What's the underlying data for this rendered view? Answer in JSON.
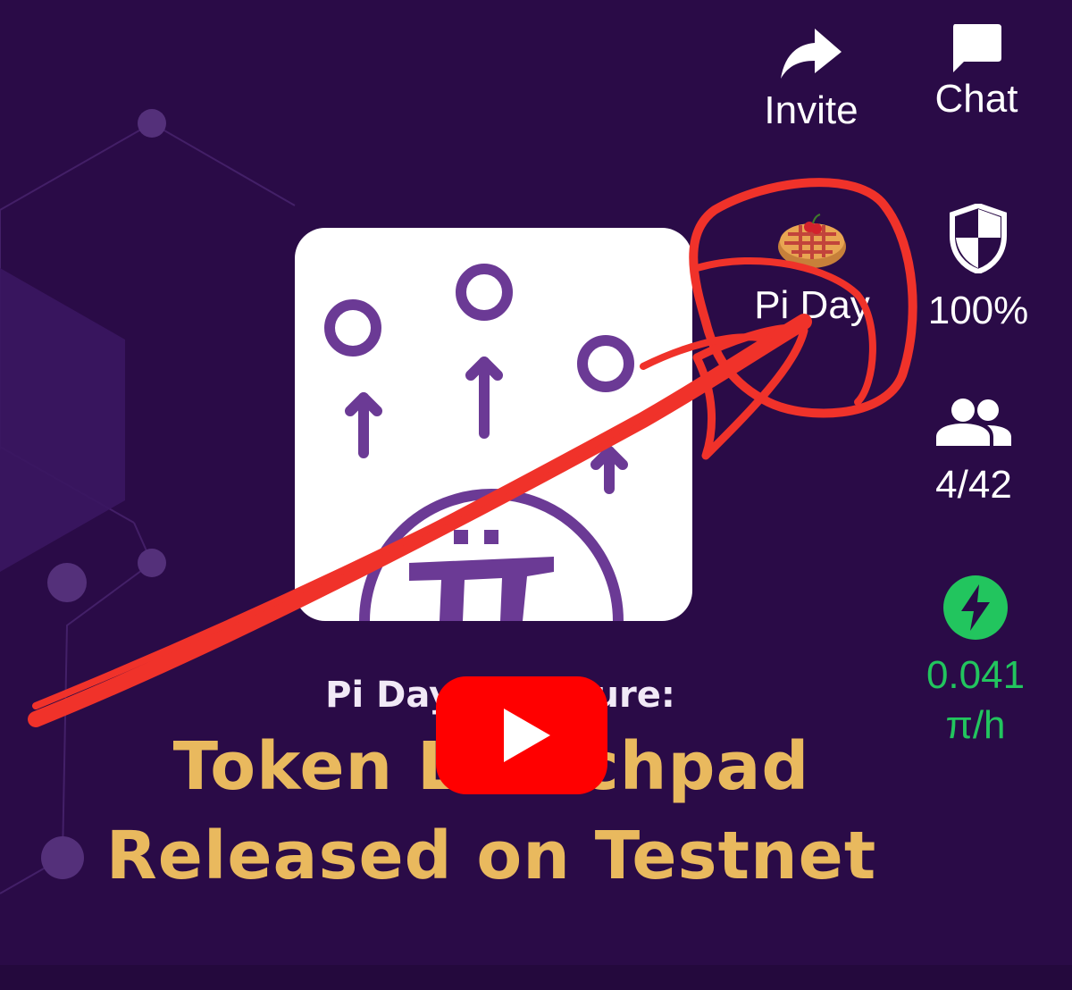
{
  "colors": {
    "background": "#2a0b47",
    "card": "#ffffff",
    "card_icon": "#6b3a95",
    "caption_gold": "#e9b95e",
    "play_red": "#ff0000",
    "mining_green": "#22c55e",
    "scribble_red": "#f0322a"
  },
  "video": {
    "caption_small": "Pi Day 2       ture:",
    "caption_line1": "Token L     chpad",
    "caption_line2": "Released on Testnet",
    "play_icon": "youtube-play-icon"
  },
  "sidebar": {
    "invite": {
      "label": "Invite",
      "icon": "share-arrow-icon"
    },
    "chat": {
      "label": "Chat",
      "icon": "chat-bubble-icon"
    },
    "pi_day": {
      "label": "Pi Day",
      "icon": "pie-icon"
    },
    "security": {
      "label": "100%",
      "icon": "shield-icon"
    },
    "team": {
      "label": "4/42",
      "icon": "people-icon"
    },
    "mining": {
      "rate": "0.041",
      "unit": "π/h",
      "icon": "lightning-icon"
    }
  }
}
